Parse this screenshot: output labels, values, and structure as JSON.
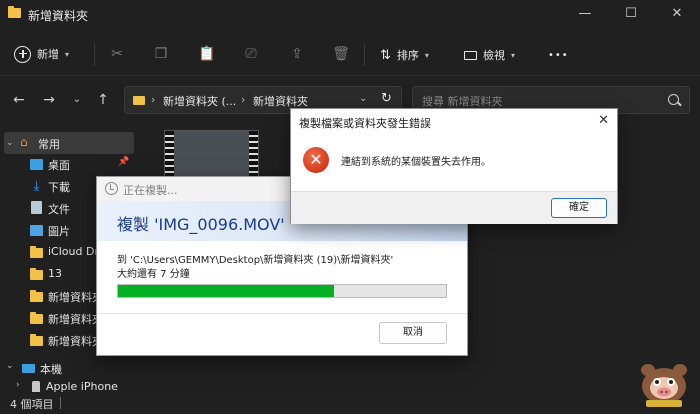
{
  "window": {
    "title": "新增資料夾",
    "controls": {
      "minimize": "—",
      "maximize": "☐",
      "close": "✕"
    }
  },
  "toolbar": {
    "new_label": "新增",
    "sort_label": "排序",
    "view_label": "檢視",
    "more_label": "•••"
  },
  "address": {
    "breadcrumbs": [
      "新增資料夾 (...",
      "新增資料夾"
    ],
    "search_placeholder": "搜尋 新增資料夾"
  },
  "sidebar": {
    "items": [
      {
        "label": "常用",
        "icon": "home-icon"
      },
      {
        "label": "桌面",
        "icon": "desktop-icon"
      },
      {
        "label": "下載",
        "icon": "download-icon"
      },
      {
        "label": "文件",
        "icon": "document-icon"
      },
      {
        "label": "圖片",
        "icon": "pictures-icon"
      },
      {
        "label": "iCloud Dr",
        "icon": "folder-icon"
      },
      {
        "label": "13",
        "icon": "folder-icon"
      },
      {
        "label": "新增資料夾",
        "icon": "folder-icon"
      },
      {
        "label": "新增資料夾",
        "icon": "folder-icon"
      },
      {
        "label": "新增資料夾",
        "icon": "folder-icon"
      },
      {
        "label": "本機",
        "icon": "pc-icon"
      },
      {
        "label": "Apple iPhone",
        "icon": "phone-icon"
      }
    ]
  },
  "status": {
    "count": "4 個項目"
  },
  "copy_dialog": {
    "title": "正在複製...",
    "heading": "複製 'IMG_0096.MOV'",
    "destination": "到 'C:\\Users\\GEMMY\\Desktop\\新增資料夾 (19)\\新增資料夾'",
    "remaining": "大約還有 7 分鐘",
    "progress": 0.66,
    "cancel_label": "取消"
  },
  "error_dialog": {
    "title": "複製檔案或資料夾發生錯誤",
    "message": "連結到系統的某個裝置失去作用。",
    "ok_label": "確定"
  },
  "colors": {
    "accent": "#2a6fd0",
    "progress": "#06b025",
    "error": "#d23a1a",
    "folder": "#f2c14a"
  }
}
